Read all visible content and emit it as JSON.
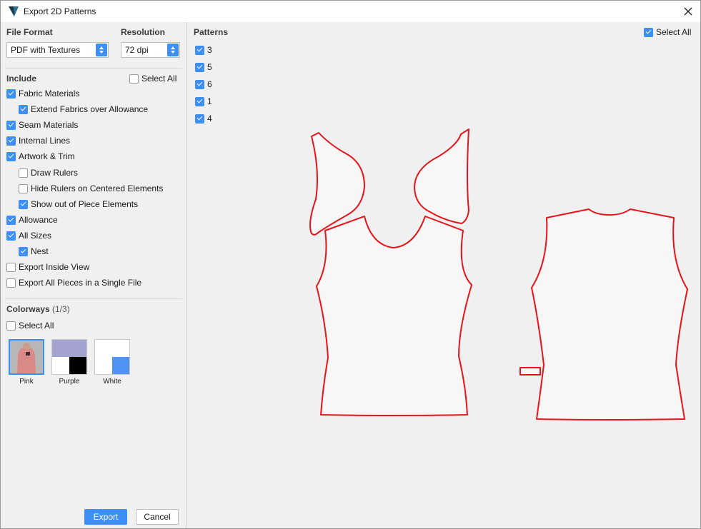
{
  "window": {
    "title": "Export 2D Patterns"
  },
  "settings": {
    "file_format_label": "File Format",
    "file_format_value": "PDF with Textures",
    "resolution_label": "Resolution",
    "resolution_value": "72 dpi"
  },
  "include": {
    "label": "Include",
    "select_all_label": "Select All",
    "select_all_checked": false,
    "options": [
      {
        "label": "Fabric Materials",
        "checked": true
      },
      {
        "label": "Extend Fabrics over Allowance",
        "checked": true
      },
      {
        "label": "Seam Materials",
        "checked": true
      },
      {
        "label": "Internal Lines",
        "checked": true
      },
      {
        "label": "Artwork & Trim",
        "checked": true
      },
      {
        "label": "Draw Rulers",
        "checked": false
      },
      {
        "label": "Hide Rulers on Centered Elements",
        "checked": false
      },
      {
        "label": "Show out of Piece Elements",
        "checked": true
      },
      {
        "label": "Allowance",
        "checked": true
      },
      {
        "label": "All Sizes",
        "checked": true
      },
      {
        "label": "Nest",
        "checked": true
      },
      {
        "label": "Export Inside View",
        "checked": false
      },
      {
        "label": "Export All Pieces in a Single File",
        "checked": false
      }
    ]
  },
  "colorways": {
    "label": "Colorways",
    "count": "(1/3)",
    "select_all_label": "Select All",
    "select_all_checked": false,
    "items": [
      {
        "name": "Pink",
        "selected": true,
        "color": "#d98a86"
      },
      {
        "name": "Purple",
        "selected": false,
        "colors": [
          "#a4a2d0",
          "#ffffff",
          "#000000"
        ]
      },
      {
        "name": "White",
        "selected": false,
        "colors": [
          "#ffffff",
          "#4f93f2"
        ]
      }
    ]
  },
  "patterns": {
    "label": "Patterns",
    "select_all_label": "Select All",
    "select_all_checked": true,
    "items": [
      {
        "label": "3",
        "checked": true
      },
      {
        "label": "5",
        "checked": true
      },
      {
        "label": "6",
        "checked": true
      },
      {
        "label": "1",
        "checked": true
      },
      {
        "label": "4",
        "checked": true
      }
    ],
    "outline_color": "#e8141b",
    "fill_color": "#f7f7f7"
  },
  "actions": {
    "export_label": "Export",
    "cancel_label": "Cancel"
  },
  "colors": {
    "accent": "#3d8ff5"
  }
}
